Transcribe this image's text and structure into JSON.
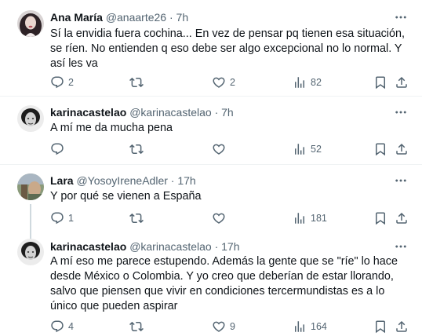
{
  "tweets": [
    {
      "name": "Ana María",
      "handle": "@anaarte26",
      "dot": "·",
      "time": "7h",
      "text": "Sí la envidia fuera cochina... En vez de pensar pq tienen esa situación, se ríen. No entienden q eso debe ser algo excepcional no lo normal. Y así les va",
      "replies": "2",
      "retweets": "",
      "likes": "2",
      "views": "82"
    },
    {
      "name": "karinacastelao",
      "handle": "@karinacastelao",
      "dot": "·",
      "time": "7h",
      "text": "A mí me da mucha pena",
      "replies": "",
      "retweets": "",
      "likes": "",
      "views": "52"
    },
    {
      "name": "Lara",
      "handle": "@YosoyIreneAdler",
      "dot": "·",
      "time": "17h",
      "text": "Y por qué se vienen a España",
      "replies": "1",
      "retweets": "",
      "likes": "",
      "views": "181"
    },
    {
      "name": "karinacastelao",
      "handle": "@karinacastelao",
      "dot": "·",
      "time": "17h",
      "text": "A mí eso me parece estupendo. Además la gente que se \"ríe\" lo hace desde México o Colombia. Y yo creo que deberían de estar llorando, salvo que piensen que vivir en condiciones tercermundistas es a lo único que pueden aspirar",
      "replies": "4",
      "retweets": "",
      "likes": "9",
      "views": "164"
    }
  ],
  "icons": {
    "more": "more-icon",
    "reply": "reply-icon",
    "retweet": "retweet-icon",
    "like": "heart-icon",
    "views": "views-icon",
    "bookmark": "bookmark-icon",
    "share": "share-icon"
  },
  "colors": {
    "text": "#0f1419",
    "secondary": "#536471",
    "divider": "#eff3f4",
    "thread_line": "#cfd9de"
  }
}
